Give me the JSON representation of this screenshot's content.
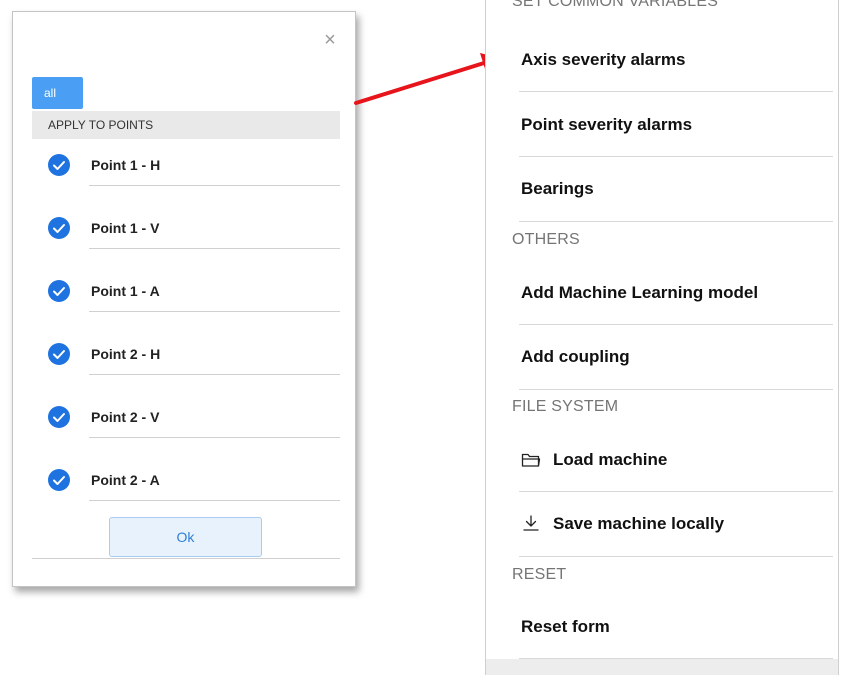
{
  "dialog": {
    "close_icon": "close-icon",
    "all_button": "all",
    "apply_header": "APPLY TO POINTS",
    "points": [
      {
        "label": "Point 1 - H",
        "checked": true
      },
      {
        "label": "Point 1 - V",
        "checked": true
      },
      {
        "label": "Point 1 - A",
        "checked": true
      },
      {
        "label": "Point 2 - H",
        "checked": true
      },
      {
        "label": "Point 2 - V",
        "checked": true
      },
      {
        "label": "Point 2 - A",
        "checked": true
      }
    ],
    "ok_button": "Ok"
  },
  "menu": {
    "sections": [
      {
        "title": "SET COMMON VARIABLES",
        "items": [
          {
            "label": "Axis severity alarms"
          },
          {
            "label": "Point severity alarms"
          },
          {
            "label": "Bearings"
          }
        ]
      },
      {
        "title": "OTHERS",
        "items": [
          {
            "label": "Add Machine Learning model"
          },
          {
            "label": "Add coupling"
          }
        ]
      },
      {
        "title": "FILE SYSTEM",
        "items": [
          {
            "label": "Load machine",
            "icon": "folder-icon"
          },
          {
            "label": "Save machine locally",
            "icon": "download-icon"
          }
        ]
      },
      {
        "title": "RESET",
        "items": [
          {
            "label": "Reset form"
          }
        ]
      }
    ]
  },
  "colors": {
    "accent_blue": "#4a9ff5",
    "check_blue": "#1f73e0",
    "arrow_red": "#e8141b"
  }
}
